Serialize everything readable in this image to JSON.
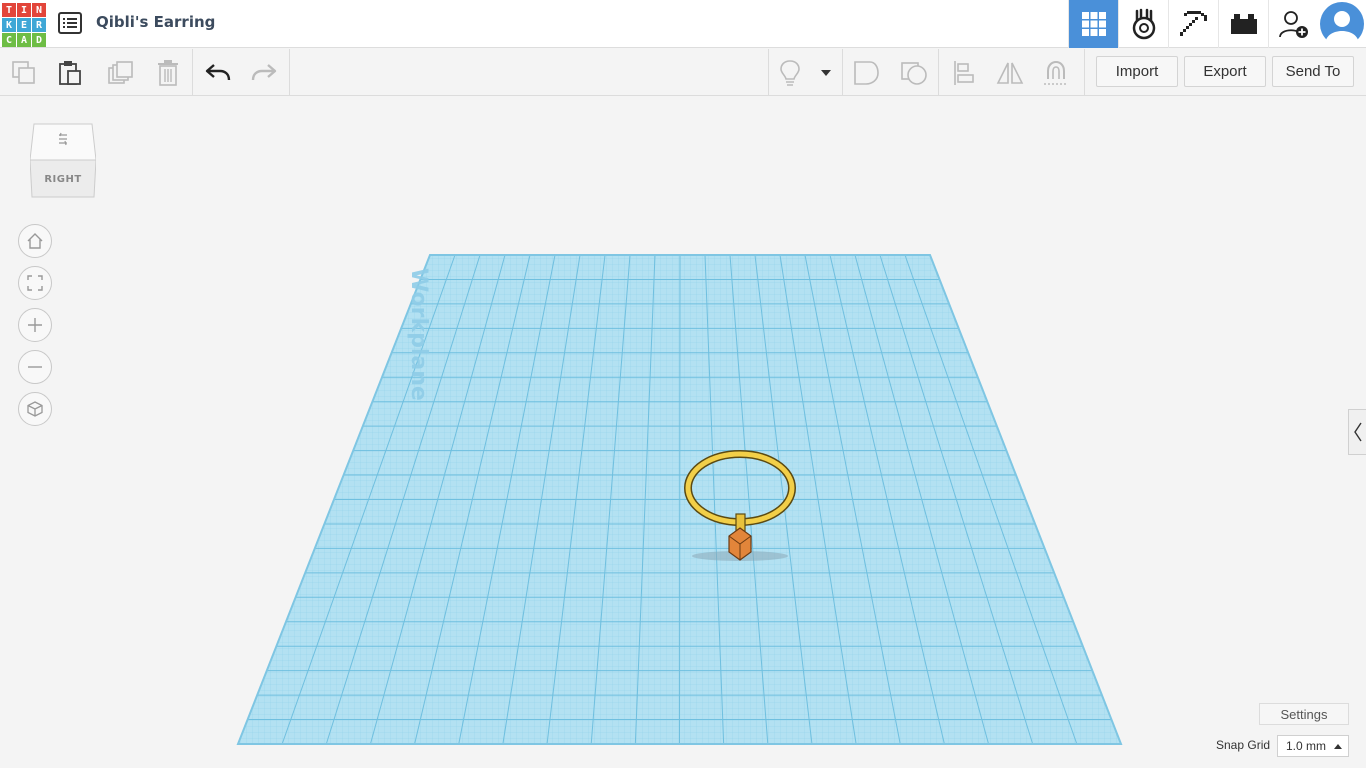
{
  "app": {
    "logo_letters": [
      "T",
      "I",
      "N",
      "K",
      "E",
      "R",
      "C",
      "A",
      "D"
    ],
    "logo_colors": [
      "#e2453a",
      "#e2453a",
      "#e2453a",
      "#3fa7d6",
      "#3fa7d6",
      "#3fa7d6",
      "#6ebd45",
      "#6ebd45",
      "#6ebd45"
    ],
    "design_title": "Qibli's Earring",
    "accent": "#4a90d9"
  },
  "topnav": {
    "items": [
      {
        "name": "3d-design-grid-icon",
        "active": true
      },
      {
        "name": "codeblocks-icon",
        "active": false
      },
      {
        "name": "minecraft-pickaxe-icon",
        "active": false
      },
      {
        "name": "lego-brick-icon",
        "active": false
      },
      {
        "name": "add-user-icon",
        "active": false
      }
    ]
  },
  "toolbar": {
    "import_label": "Import",
    "export_label": "Export",
    "send_to_label": "Send To"
  },
  "viewcube": {
    "face_label": "RIGHT"
  },
  "workplane": {
    "label": "Workplane",
    "color": "#a8dbef"
  },
  "footer": {
    "settings_label": "Settings",
    "snap_grid_label": "Snap Grid",
    "snap_grid_value": "1.0 mm"
  }
}
